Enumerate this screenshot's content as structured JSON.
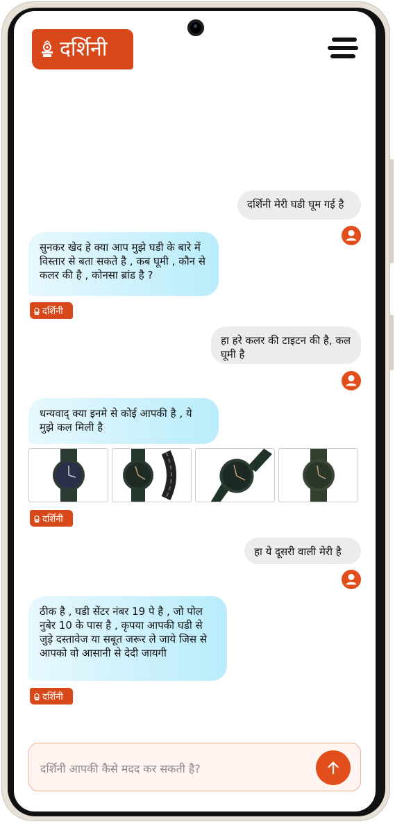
{
  "brand": {
    "name": "दर्शिनी",
    "accent": "#d9481a"
  },
  "messages": [
    {
      "role": "user",
      "text": "दर्शिनी मेरी घडी घूम गई है"
    },
    {
      "role": "bot",
      "text": "सुनकर खेद हे क्या आप मुझे घडी के बारे में विस्तार से बता सकते है , कब घूमी , कौन से कलर की है , कोनसा ब्रांड है ?"
    },
    {
      "role": "user",
      "text": "हा हरे कलर की टाइटन की है, कल घूमी है"
    },
    {
      "role": "bot",
      "text": "धन्यवाद् क्या इनमे से कोई आपकी है , ये मुझे कल मिली है"
    },
    {
      "role": "user",
      "text": "हा ये दूसरी वाली मेरी है"
    },
    {
      "role": "bot",
      "text": "ठीक है , घडी सेंटर नंबर 19 पे है , जो पोल नुबेर 10 के पास है , कृपया आपकी घडी से जुड़े दस्तावेज या सबूत जरूर ले जाये जिस से आपको वो आसानी से देदी जायगी"
    }
  ],
  "watches": [
    "green-watch-front-icon",
    "green-watch-side-icon",
    "green-watch-angled-icon",
    "green-watch-gold-icon"
  ],
  "composer": {
    "placeholder": "दर्शिनी आपकी कैसे मदद कर सकती है?"
  }
}
